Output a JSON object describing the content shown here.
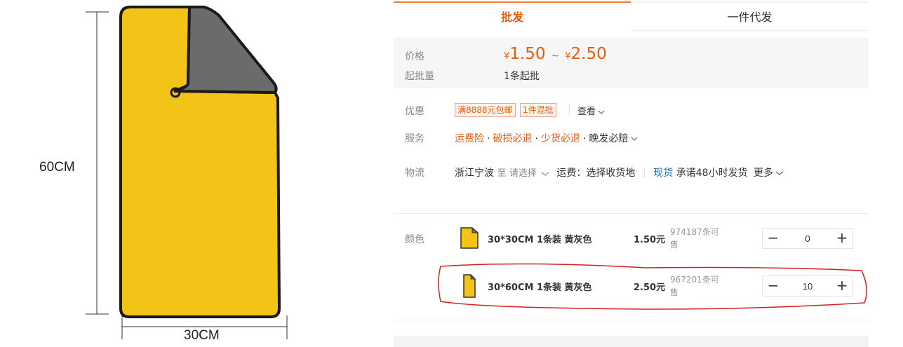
{
  "product_image": {
    "height_label": "60CM",
    "width_label": "30CM",
    "towel_color": "#f3c417",
    "corner_color": "#6b6b6b"
  },
  "tabs": [
    {
      "label": "批发",
      "active": true
    },
    {
      "label": "一件代发",
      "active": false
    }
  ],
  "price": {
    "label": "价格",
    "currency": "¥",
    "min": "1.50",
    "max": "2.50",
    "tilde": "~",
    "moq_label": "起批量",
    "moq_value": "1条起批"
  },
  "promotions": {
    "label": "优惠",
    "tags": [
      "满8888元包邮",
      "1件混批"
    ],
    "view_label": "查看"
  },
  "services": {
    "label": "服务",
    "items": [
      "运费险",
      "破损必退",
      "少货必退"
    ],
    "extra": "晚发必赔"
  },
  "logistics": {
    "label": "物流",
    "origin": "浙江宁波",
    "to": "至",
    "destination_placeholder": "请选择",
    "shipping_fee": "运费：选择收货地",
    "stock_status": "现货",
    "promise": "承诺48小时发货",
    "more": "更多"
  },
  "variants": {
    "label": "颜色",
    "items": [
      {
        "name": "30*30CM 1条装 黄灰色",
        "price": "1.50元",
        "stock": "974187条可售",
        "quantity": "0"
      },
      {
        "name": "30*60CM 1条装 黄灰色",
        "price": "2.50元",
        "stock": "967201条可售",
        "quantity": "10",
        "highlighted": true
      }
    ]
  },
  "colors": {
    "accent": "#e85a0c",
    "link_blue": "#1a6fc4",
    "annotation_red": "#d42020"
  },
  "icons": [
    "chevron-down-icon",
    "minus-icon",
    "plus-icon"
  ]
}
